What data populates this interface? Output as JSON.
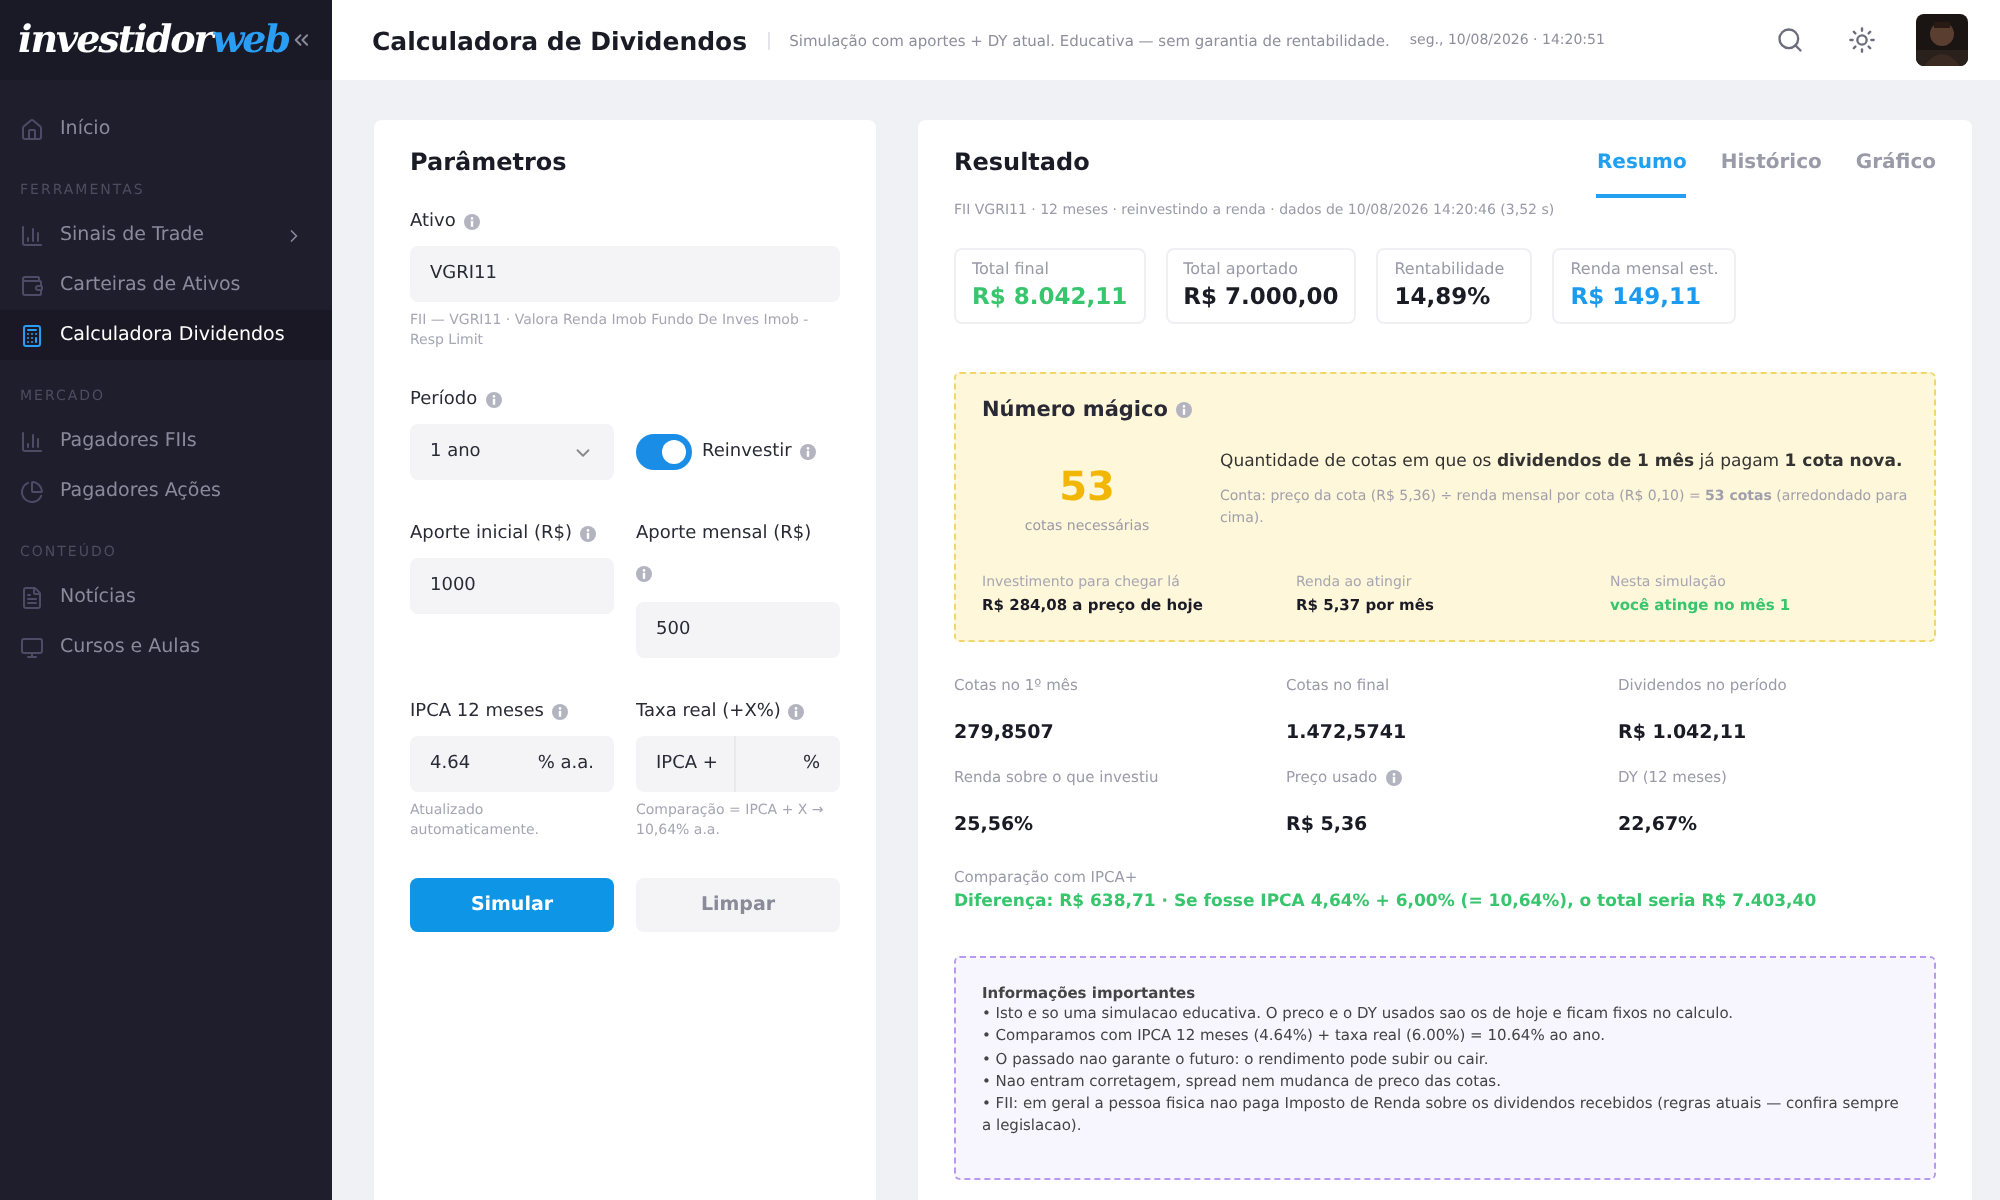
{
  "sidebar": {
    "logo": {
      "part1": "investidor",
      "part2": "web"
    },
    "nav": [
      {
        "kind": "item",
        "label": "Início",
        "selected": false,
        "submenu": false
      },
      {
        "kind": "section",
        "label": "FERRAMENTAS"
      },
      {
        "kind": "item",
        "label": "Sinais de Trade",
        "selected": false,
        "submenu": true
      },
      {
        "kind": "item",
        "label": "Carteiras de Ativos",
        "selected": false,
        "submenu": false
      },
      {
        "kind": "item",
        "label": "Calculadora Dividendos",
        "selected": true,
        "submenu": false
      },
      {
        "kind": "section",
        "label": "MERCADO"
      },
      {
        "kind": "item",
        "label": "Pagadores FIIs",
        "selected": false,
        "submenu": false
      },
      {
        "kind": "item",
        "label": "Pagadores Ações",
        "selected": false,
        "submenu": false
      },
      {
        "kind": "section",
        "label": "CONTEÚDO"
      },
      {
        "kind": "item",
        "label": "Notícias",
        "selected": false,
        "submenu": false
      },
      {
        "kind": "item",
        "label": "Cursos e Aulas",
        "selected": false,
        "submenu": false
      }
    ]
  },
  "header": {
    "title": "Calculadora de Dividendos",
    "subtitle": "Simulação com aportes + DY atual. Educativa — sem garantia de rentabilidade.",
    "datetime": "seg., 10/08/2026 · 14:20:51"
  },
  "params": {
    "title": "Parâmetros",
    "asset": {
      "label": "Ativo",
      "value": "VGRI11",
      "hint": "FII — VGRI11 · Valora Renda Imob Fundo De Inves Imob -Resp Limit"
    },
    "period": {
      "label": "Período",
      "value": "1 ano"
    },
    "reinvest": {
      "label": "Reinvestir",
      "on": true
    },
    "initial": {
      "label": "Aporte inicial (R$)",
      "value": "1000"
    },
    "monthly": {
      "label": "Aporte mensal (R$)",
      "value": "500"
    },
    "ipca": {
      "label": "IPCA 12 meses",
      "value": "4.64",
      "suffix": "% a.a.",
      "hint": "Atualizado automaticamente."
    },
    "real_rate": {
      "label": "Taxa real (+X%)",
      "prefix": "IPCA +",
      "suffix": "%",
      "hint": "Comparação = IPCA + X → 10,64% a.a."
    },
    "buttons": [
      {
        "label": "Simular",
        "kind": "primary"
      },
      {
        "label": "Limpar",
        "kind": "secondary"
      }
    ]
  },
  "result": {
    "title": "Resultado",
    "tabs": [
      {
        "label": "Resumo",
        "selected": true
      },
      {
        "label": "Histórico",
        "selected": false
      },
      {
        "label": "Gráfico",
        "selected": false
      }
    ],
    "meta": "FII VGRI11 · 12 meses · reinvestindo a renda · dados de 10/08/2026 14:20:46 (3,52 s)",
    "stats": [
      {
        "label": "Total final",
        "value": "R$ 8.042,11",
        "color": "#37c56d"
      },
      {
        "label": "Total aportado",
        "value": "R$ 7.000,00",
        "color": "#1b1b26"
      },
      {
        "label": "Rentabilidade",
        "value": "14,89%",
        "color": "#1b1b26"
      },
      {
        "label": "Renda mensal est.",
        "value": "R$ 149,11",
        "color": "#1a9bf0"
      }
    ],
    "magic": {
      "title": "Número mágico",
      "number": "53",
      "caption": "cotas necessárias",
      "description": "Quantidade de cotas em que os **dividendos de 1 mês** já pagam **1 cota nova.**",
      "formula": "Conta: preço da cota (R$ 5,36) ÷ renda mensal por cota (R$ 0,10) = **53 cotas** (arredondado para cima).",
      "facts": [
        {
          "label": "Investimento para chegar lá",
          "value": "R$ 284,08 a preço de hoje",
          "color": "#1b1b26"
        },
        {
          "label": "Renda ao atingir",
          "value": "R$ 5,37 por mês",
          "color": "#1b1b26"
        },
        {
          "label": "Nesta simulação",
          "value": "você atinge no mês 1",
          "color": "#37c56d"
        }
      ]
    },
    "metrics": [
      {
        "label": "Cotas no 1º mês",
        "value": "279,8507",
        "info": false
      },
      {
        "label": "Cotas no final",
        "value": "1.472,5741",
        "info": false
      },
      {
        "label": "Dividendos no período",
        "value": "R$ 1.042,11",
        "info": false
      },
      {
        "label": "Renda sobre o que investiu",
        "value": "25,56%",
        "info": false
      },
      {
        "label": "Preço usado",
        "value": "R$ 5,36",
        "info": true
      },
      {
        "label": "DY (12 meses)",
        "value": "22,67%",
        "info": false
      }
    ],
    "comparison": {
      "label": "Comparação com IPCA+",
      "text": "Diferença: R$ 638,71 · Se fosse IPCA 4,64% + 6,00% (= 10,64%), o total seria R$ 7.403,40"
    },
    "notes": {
      "title": "Informações importantes",
      "lines": [
        "• Isto e so uma simulacao educativa. O preco e o DY usados sao os de hoje e ficam fixos no calculo.",
        "• Comparamos com IPCA 12 meses (4.64%) + taxa real (6.00%) = 10.64% ao ano.",
        "• O passado nao garante o futuro: o rendimento pode subir ou cair.",
        "• Nao entram corretagem, spread nem mudanca de preco das cotas.",
        "• FII: em geral a pessoa fisica nao paga Imposto de Renda sobre os dividendos recebidos (regras atuais — confira sempre a legislacao)."
      ]
    }
  }
}
